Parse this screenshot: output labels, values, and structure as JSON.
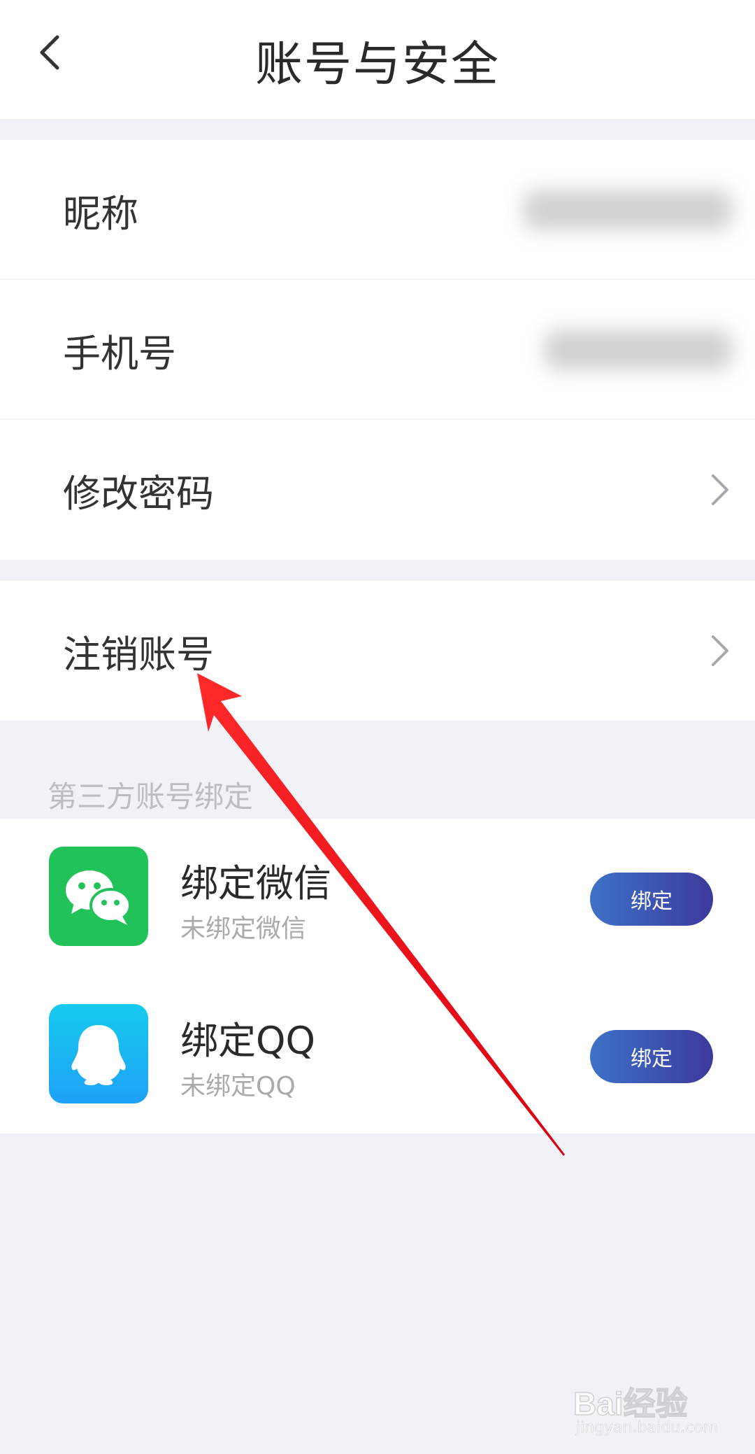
{
  "header": {
    "title": "账号与安全"
  },
  "settings": {
    "nickname_label": "昵称",
    "phone_label": "手机号",
    "change_password_label": "修改密码",
    "cancel_account_label": "注销账号"
  },
  "binding": {
    "section_label": "第三方账号绑定",
    "wechat": {
      "title": "绑定微信",
      "status": "未绑定微信",
      "button": "绑定",
      "icon": "wechat-icon"
    },
    "qq": {
      "title": "绑定QQ",
      "status": "未绑定QQ",
      "button": "绑定",
      "icon": "qq-icon"
    }
  },
  "colors": {
    "background": "#f1f2f7",
    "wechat": "#22c25a",
    "qq": "#1fa1f7",
    "button_start": "#3e72c8",
    "button_end": "#3c3a9c",
    "annotation_arrow": "#e8121a"
  },
  "watermark": {
    "brand": "Bai经验",
    "url": "jingyan.baidu.com"
  }
}
